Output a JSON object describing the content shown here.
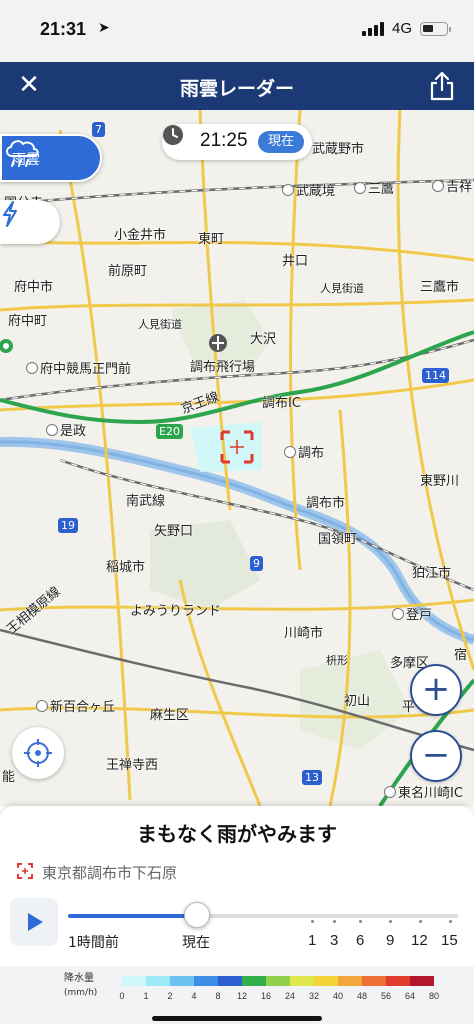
{
  "status_bar": {
    "time": "21:31",
    "network": "4G"
  },
  "nav": {
    "title": "雨雲レーダー",
    "close_icon": "close-icon",
    "share_icon": "share-icon"
  },
  "map": {
    "time_chip": {
      "time": "21:25",
      "now_label": "現在"
    },
    "rain_tab_label": "雨雲",
    "zoom_in": "+",
    "zoom_out": "−",
    "labels": [
      {
        "text": "武蔵野市"
      },
      {
        "text": "国分寺"
      },
      {
        "text": "武蔵境"
      },
      {
        "text": "三鷹"
      },
      {
        "text": "吉祥"
      },
      {
        "text": "小金井市"
      },
      {
        "text": "東町"
      },
      {
        "text": "井口"
      },
      {
        "text": "前原町"
      },
      {
        "text": "府中市"
      },
      {
        "text": "人見街道"
      },
      {
        "text": "三鷹市"
      },
      {
        "text": "府中町"
      },
      {
        "text": "人見街道"
      },
      {
        "text": "大沢"
      },
      {
        "text": "府中競馬正門前"
      },
      {
        "text": "調布飛行場"
      },
      {
        "text": "114"
      },
      {
        "text": "京王線"
      },
      {
        "text": "調布IC"
      },
      {
        "text": "是政"
      },
      {
        "text": "E20"
      },
      {
        "text": "調布"
      },
      {
        "text": "東野川"
      },
      {
        "text": "南武線"
      },
      {
        "text": "調布市"
      },
      {
        "text": "19"
      },
      {
        "text": "矢野口"
      },
      {
        "text": "国領町"
      },
      {
        "text": "稲城市"
      },
      {
        "text": "9"
      },
      {
        "text": "狛江市"
      },
      {
        "text": "王相模原線"
      },
      {
        "text": "よみうりランド"
      },
      {
        "text": "登戸"
      },
      {
        "text": "川崎市"
      },
      {
        "text": "宿"
      },
      {
        "text": "枡形"
      },
      {
        "text": "多摩区"
      },
      {
        "text": "新百合ヶ丘"
      },
      {
        "text": "初山"
      },
      {
        "text": "麻生区"
      },
      {
        "text": "平"
      },
      {
        "text": "王禅寺西"
      },
      {
        "text": "13"
      },
      {
        "text": "能"
      },
      {
        "text": "東名川崎IC"
      },
      {
        "text": "7"
      }
    ]
  },
  "sheet": {
    "forecast_message": "まもなく雨がやみます",
    "location": "東京都調布市下石原",
    "timeline": {
      "position_fraction": 0.33,
      "label_start": "1時間前",
      "label_now": "現在",
      "future_ticks": [
        "1",
        "3",
        "6",
        "9",
        "12",
        "15"
      ]
    },
    "legend": {
      "title": "降水量",
      "unit": "(mm/h)",
      "values": [
        "0",
        "1",
        "2",
        "4",
        "8",
        "12",
        "16",
        "24",
        "32",
        "40",
        "48",
        "56",
        "64",
        "80"
      ],
      "colors": [
        "#cdf7fb",
        "#9ee9f6",
        "#6cc2f0",
        "#3d8ee6",
        "#2c5fd0",
        "#2fb04a",
        "#8fd14a",
        "#dfe84a",
        "#f5d43a",
        "#f3a63a",
        "#ee6f35",
        "#e23c2f",
        "#b2182b"
      ]
    }
  }
}
